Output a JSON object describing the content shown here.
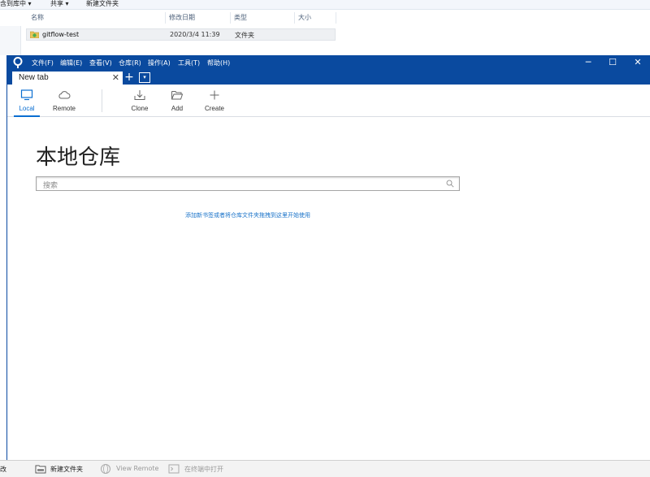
{
  "explorer": {
    "toolbar": {
      "include": "含到库中 ▾",
      "share": "共享 ▾",
      "new_folder": "新建文件夹"
    },
    "columns": [
      "名称",
      "修改日期",
      "类型",
      "大小"
    ],
    "rows": [
      {
        "name": "gitflow-test",
        "date": "2020/3/4 11:39",
        "type": "文件夹",
        "size": ""
      }
    ],
    "statusbar": {
      "left_fragment": "改",
      "new_folder": "新建文件夹",
      "view_remote": "View Remote",
      "open_terminal": "在终端中打开"
    }
  },
  "sourcetree": {
    "menu": [
      "文件(F)",
      "编辑(E)",
      "查看(V)",
      "仓库(R)",
      "操作(A)",
      "工具(T)",
      "帮助(H)"
    ],
    "window_controls": {
      "minimize": "─",
      "maximize": "☐",
      "close": "✕"
    },
    "tab": {
      "label": "New tab",
      "close": "✕",
      "add": "+",
      "dropdown": "▾"
    },
    "toolbar": {
      "local": "Local",
      "remote": "Remote",
      "clone": "Clone",
      "add": "Add",
      "create": "Create"
    },
    "page_title": "本地仓库",
    "search_placeholder": "搜索",
    "hint": "添加新书签或者将仓库文件夹拖拽到这里开始使用"
  },
  "colors": {
    "accent": "#0a4a9f",
    "link": "#1a73c9",
    "active_tab": "#0a6ed1"
  }
}
